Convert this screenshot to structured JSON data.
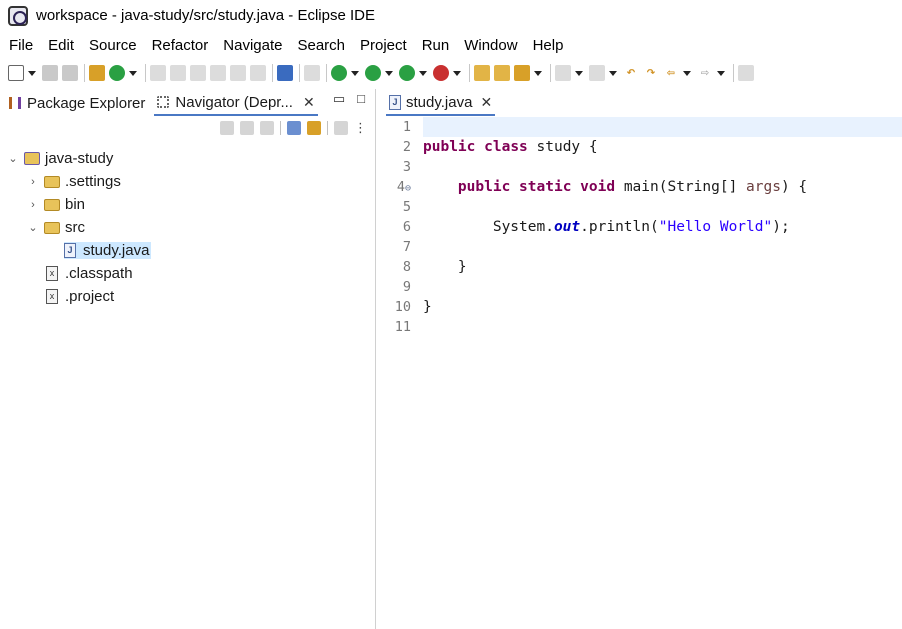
{
  "window": {
    "title": "workspace - java-study/src/study.java - Eclipse IDE"
  },
  "menu": [
    "File",
    "Edit",
    "Source",
    "Refactor",
    "Navigate",
    "Search",
    "Project",
    "Run",
    "Window",
    "Help"
  ],
  "left_pane": {
    "tabs": [
      {
        "label": "Package Explorer",
        "icon": "package-explorer-icon"
      },
      {
        "label": "Navigator (Depr...",
        "icon": "navigator-icon"
      }
    ],
    "close_glyph": "✕",
    "tree": [
      {
        "label": "java-study",
        "level": 0,
        "expanded": true,
        "type": "project"
      },
      {
        "label": ".settings",
        "level": 1,
        "expanded": false,
        "type": "folder"
      },
      {
        "label": "bin",
        "level": 1,
        "expanded": false,
        "type": "folder"
      },
      {
        "label": "src",
        "level": 1,
        "expanded": true,
        "type": "folder"
      },
      {
        "label": "study.java",
        "level": 2,
        "type": "java-file",
        "selected": true
      },
      {
        "label": ".classpath",
        "level": 1,
        "type": "xml-file"
      },
      {
        "label": ".project",
        "level": 1,
        "type": "xml-file"
      }
    ]
  },
  "editor": {
    "tab_label": "study.java",
    "line_numbers": [
      "1",
      "2",
      "3",
      "4",
      "5",
      "6",
      "7",
      "8",
      "9",
      "10",
      "11"
    ],
    "code": {
      "l2_kw1": "public",
      "l2_kw2": "class",
      "l2_rest": " study {",
      "l4_indent": "    ",
      "l4_kw1": "public",
      "l4_kw2": "static",
      "l4_kw3": "void",
      "l4_mid": " main(String[] ",
      "l4_param": "args",
      "l4_end": ") {",
      "l6_a": "        System.",
      "l6_field": "out",
      "l6_b": ".println(",
      "l6_str": "\"Hello World\"",
      "l6_c": ");",
      "l8": "    }",
      "l10": "}"
    }
  },
  "colors": {
    "keyword": "#7f0055",
    "string": "#2a00ff",
    "field": "#0000c0",
    "selection": "#cde8ff",
    "current_line": "#e8f2fe"
  }
}
